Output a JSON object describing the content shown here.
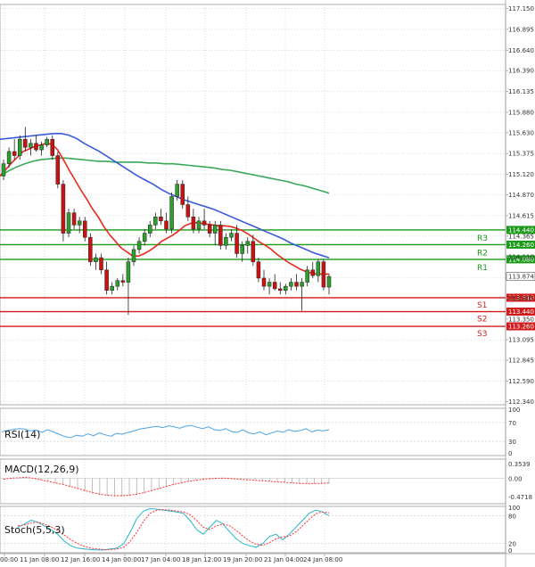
{
  "chart_data": {
    "type": "candlestick",
    "colors": {
      "bull": "#2e9e2e",
      "bear": "#cc1111",
      "ma_fast": "#e8281c",
      "ma_mid": "#3a5bd9",
      "ma_slow": "#3aa85a",
      "resistance": "#1a9a1a",
      "support": "#d11a1a",
      "rsi": "#4da3e8",
      "macd": "#ff3030",
      "stoch_k": "#27b6c9",
      "stoch_d": "#ff3030",
      "grid": "#c8c8c8",
      "axis": "#9a9a9a"
    },
    "price_ticks": [
      "117.150",
      "116.895",
      "116.640",
      "116.390",
      "116.135",
      "115.880",
      "115.630",
      "115.375",
      "115.120",
      "114.870",
      "114.615",
      "114.365",
      "114.110",
      "113.855",
      "113.605",
      "113.350",
      "113.095",
      "112.845",
      "112.590",
      "112.340"
    ],
    "price_ylim": [
      112.3,
      117.2
    ],
    "time_ticks": [
      "00:00",
      "11 Jan 08:00",
      "12 Jan 16:00",
      "14 Jan 00:00",
      "17 Jan 04:00",
      "18 Jan 12:00",
      "19 Jan 20:00",
      "21 Jan 04:00",
      "24 Jan 08:00"
    ],
    "current_price": "113.874",
    "levels": [
      {
        "name": "R3",
        "value": 114.44,
        "tag": "114.440",
        "type": "resistance"
      },
      {
        "name": "R2",
        "value": 114.26,
        "tag": "114.260",
        "type": "resistance"
      },
      {
        "name": "R1",
        "value": 114.08,
        "tag": "114.080",
        "type": "resistance"
      },
      {
        "name": "S1",
        "value": 113.61,
        "tag": "113.610",
        "type": "support"
      },
      {
        "name": "S2",
        "value": 113.44,
        "tag": "113.440",
        "type": "support"
      },
      {
        "name": "S3",
        "value": 113.26,
        "tag": "113.260",
        "type": "support"
      }
    ],
    "candles": [
      [
        115.1,
        115.3,
        115.05,
        115.25
      ],
      [
        115.25,
        115.45,
        115.2,
        115.4
      ],
      [
        115.4,
        115.55,
        115.3,
        115.35
      ],
      [
        115.35,
        115.6,
        115.3,
        115.55
      ],
      [
        115.55,
        115.7,
        115.4,
        115.45
      ],
      [
        115.45,
        115.55,
        115.35,
        115.5
      ],
      [
        115.5,
        115.6,
        115.4,
        115.42
      ],
      [
        115.42,
        115.52,
        115.35,
        115.48
      ],
      [
        115.48,
        115.58,
        115.45,
        115.55
      ],
      [
        115.55,
        115.6,
        115.3,
        115.35
      ],
      [
        115.35,
        115.4,
        114.95,
        115.0
      ],
      [
        115.0,
        115.05,
        114.3,
        114.4
      ],
      [
        114.4,
        114.7,
        114.35,
        114.65
      ],
      [
        114.65,
        114.7,
        114.45,
        114.5
      ],
      [
        114.5,
        114.6,
        114.4,
        114.55
      ],
      [
        114.55,
        114.6,
        114.3,
        114.35
      ],
      [
        114.35,
        114.4,
        114.0,
        114.05
      ],
      [
        114.05,
        114.15,
        113.95,
        114.1
      ],
      [
        114.1,
        114.15,
        113.9,
        113.95
      ],
      [
        113.95,
        114.05,
        113.65,
        113.7
      ],
      [
        113.7,
        113.8,
        113.65,
        113.75
      ],
      [
        113.75,
        113.85,
        113.7,
        113.82
      ],
      [
        113.82,
        113.9,
        113.75,
        113.8
      ],
      [
        113.8,
        114.1,
        113.4,
        114.05
      ],
      [
        114.05,
        114.25,
        114.0,
        114.2
      ],
      [
        114.2,
        114.35,
        114.15,
        114.3
      ],
      [
        114.3,
        114.45,
        114.25,
        114.4
      ],
      [
        114.4,
        114.55,
        114.35,
        114.5
      ],
      [
        114.5,
        114.65,
        114.45,
        114.6
      ],
      [
        114.6,
        114.7,
        114.5,
        114.55
      ],
      [
        114.55,
        114.65,
        114.4,
        114.45
      ],
      [
        114.45,
        114.9,
        114.4,
        114.85
      ],
      [
        114.85,
        115.05,
        114.8,
        115.0
      ],
      [
        115.0,
        115.05,
        114.7,
        114.75
      ],
      [
        114.75,
        114.85,
        114.55,
        114.6
      ],
      [
        114.6,
        114.7,
        114.4,
        114.45
      ],
      [
        114.45,
        114.6,
        114.4,
        114.55
      ],
      [
        114.55,
        114.7,
        114.45,
        114.5
      ],
      [
        114.5,
        114.55,
        114.35,
        114.4
      ],
      [
        114.4,
        114.55,
        114.25,
        114.5
      ],
      [
        114.5,
        114.55,
        114.2,
        114.25
      ],
      [
        114.25,
        114.4,
        114.2,
        114.35
      ],
      [
        114.35,
        114.45,
        114.3,
        114.4
      ],
      [
        114.4,
        114.5,
        114.1,
        114.15
      ],
      [
        114.15,
        114.3,
        114.05,
        114.25
      ],
      [
        114.25,
        114.35,
        114.15,
        114.3
      ],
      [
        114.3,
        114.38,
        114.0,
        114.05
      ],
      [
        114.05,
        114.1,
        113.8,
        113.85
      ],
      [
        113.85,
        113.95,
        113.7,
        113.75
      ],
      [
        113.75,
        113.85,
        113.65,
        113.8
      ],
      [
        113.8,
        113.9,
        113.7,
        113.72
      ],
      [
        113.72,
        113.8,
        113.65,
        113.7
      ],
      [
        113.7,
        113.78,
        113.65,
        113.75
      ],
      [
        113.75,
        113.85,
        113.7,
        113.8
      ],
      [
        113.8,
        113.9,
        113.7,
        113.75
      ],
      [
        113.75,
        113.85,
        113.45,
        113.8
      ],
      [
        113.8,
        114.0,
        113.75,
        113.95
      ],
      [
        113.95,
        114.05,
        113.85,
        113.88
      ],
      [
        113.88,
        114.08,
        113.8,
        114.05
      ],
      [
        114.05,
        114.08,
        113.7,
        113.74
      ],
      [
        113.74,
        113.9,
        113.65,
        113.87
      ]
    ],
    "ma_fast": [
      115.1,
      115.18,
      115.26,
      115.33,
      115.4,
      115.43,
      115.46,
      115.48,
      115.5,
      115.49,
      115.42,
      115.3,
      115.17,
      115.05,
      114.93,
      114.82,
      114.7,
      114.6,
      114.48,
      114.38,
      114.3,
      114.22,
      114.17,
      114.12,
      114.12,
      114.15,
      114.19,
      114.24,
      114.3,
      114.34,
      114.38,
      114.43,
      114.49,
      114.52,
      114.53,
      114.52,
      114.51,
      114.5,
      114.49,
      114.49,
      114.48,
      114.46,
      114.43,
      114.39,
      114.34,
      114.29,
      114.25,
      114.2,
      114.14,
      114.09,
      114.04,
      114.0,
      113.96,
      113.93,
      113.91,
      113.9,
      113.9,
      113.9
    ],
    "ma_mid": [
      115.55,
      115.56,
      115.57,
      115.58,
      115.59,
      115.6,
      115.61,
      115.62,
      115.62,
      115.6,
      115.56,
      115.5,
      115.45,
      115.4,
      115.34,
      115.28,
      115.22,
      115.16,
      115.1,
      115.05,
      115.0,
      114.94,
      114.89,
      114.85,
      114.81,
      114.78,
      114.75,
      114.72,
      114.69,
      114.65,
      114.61,
      114.57,
      114.53,
      114.49,
      114.45,
      114.41,
      114.37,
      114.33,
      114.28,
      114.24,
      114.2,
      114.16,
      114.13,
      114.1
    ],
    "ma_slow": [
      115.1,
      115.16,
      115.21,
      115.25,
      115.28,
      115.3,
      115.31,
      115.32,
      115.32,
      115.31,
      115.3,
      115.29,
      115.28,
      115.28,
      115.27,
      115.27,
      115.27,
      115.27,
      115.26,
      115.26,
      115.25,
      115.25,
      115.24,
      115.23,
      115.22,
      115.21,
      115.2,
      115.18,
      115.17,
      115.15,
      115.13,
      115.11,
      115.09,
      115.07,
      115.05,
      115.03,
      115.0,
      114.98,
      114.95,
      114.92,
      114.89
    ],
    "rsi": {
      "label": "RSI(14)",
      "ticks": [
        "100",
        "70",
        "30",
        "0"
      ],
      "values": [
        50,
        53,
        55,
        57,
        56,
        52,
        54,
        49,
        55,
        50,
        45,
        40,
        38,
        43,
        41,
        46,
        42,
        48,
        44,
        41,
        47,
        45,
        49,
        52,
        56,
        58,
        60,
        62,
        59,
        63,
        61,
        58,
        62,
        64,
        60,
        57,
        61,
        55,
        53,
        57,
        51,
        49,
        55,
        48,
        46,
        50,
        44,
        48,
        52,
        49,
        55,
        51,
        53,
        57,
        50,
        54,
        52,
        55
      ]
    },
    "macd": {
      "label": "MACD(12,26,9)",
      "ticks": [
        "0.3539",
        "0.00",
        "-0.4718"
      ],
      "values": [
        -0.02,
        0.0,
        0.01,
        0.02,
        0.0,
        -0.03,
        -0.06,
        -0.09,
        -0.12,
        -0.16,
        -0.2,
        -0.24,
        -0.28,
        -0.31,
        -0.33,
        -0.34,
        -0.34,
        -0.33,
        -0.31,
        -0.28,
        -0.24,
        -0.2,
        -0.16,
        -0.12,
        -0.09,
        -0.06,
        -0.04,
        -0.02,
        -0.01,
        0.0,
        0.0,
        -0.01,
        -0.02,
        -0.03,
        -0.04,
        -0.05,
        -0.06,
        -0.07,
        -0.08,
        -0.09,
        -0.1,
        -0.1,
        -0.1,
        -0.1,
        -0.09
      ]
    },
    "stoch": {
      "label": "Stoch(5,5,3)",
      "ticks": [
        "100",
        "80",
        "20",
        "0"
      ],
      "k": [
        55,
        62,
        70,
        66,
        58,
        50,
        40,
        25,
        15,
        10,
        8,
        7,
        6,
        6,
        8,
        10,
        20,
        45,
        75,
        90,
        95,
        94,
        92,
        90,
        88,
        85,
        70,
        50,
        40,
        55,
        70,
        62,
        45,
        30,
        20,
        15,
        12,
        20,
        35,
        40,
        28,
        40,
        55,
        70,
        85,
        92,
        88,
        80
      ],
      "d": [
        58,
        60,
        64,
        66,
        62,
        56,
        48,
        38,
        28,
        20,
        14,
        10,
        8,
        7,
        7,
        8,
        12,
        25,
        45,
        68,
        85,
        92,
        93,
        92,
        90,
        88,
        82,
        70,
        55,
        50,
        58,
        62,
        58,
        48,
        36,
        25,
        18,
        16,
        22,
        30,
        34,
        36,
        45,
        58,
        72,
        84,
        88,
        86
      ]
    }
  }
}
